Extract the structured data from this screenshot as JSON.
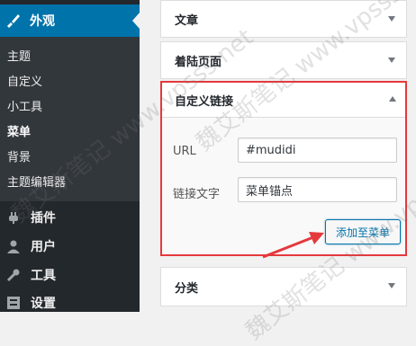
{
  "sidebar": {
    "active_menu": {
      "label": "外观",
      "icon": "paintbrush-icon"
    },
    "submenu": [
      "主题",
      "自定义",
      "小工具",
      "菜单",
      "背景",
      "主题编辑器"
    ],
    "current_submenu": "菜单",
    "menu_items": [
      {
        "label": "插件",
        "icon": "plugin-icon"
      },
      {
        "label": "用户",
        "icon": "user-icon"
      },
      {
        "label": "工具",
        "icon": "wrench-icon"
      },
      {
        "label": "设置",
        "icon": "settings-icon"
      }
    ]
  },
  "accordion": {
    "sections": [
      "文章",
      "着陆页面"
    ],
    "open_section": {
      "title": "自定义链接",
      "url_label": "URL",
      "url_value": "#mudidi",
      "text_label": "链接文字",
      "text_value": "菜单锚点",
      "add_button": "添加至菜单"
    },
    "bottom_section": "分类"
  },
  "watermark": [
    "魏艾斯笔记 www.vpsss.net",
    "魏艾斯笔记 www.vpsss.net",
    "魏艾斯笔记 www.vpsss.net"
  ],
  "colors": {
    "sidebar": "#23282d",
    "active": "#0073aa",
    "highlight_box": "#e4393c"
  }
}
